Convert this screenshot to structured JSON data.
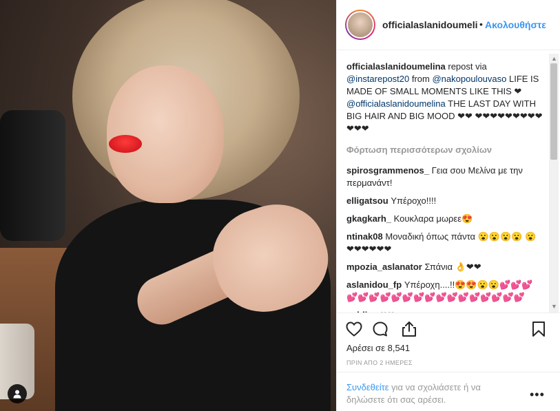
{
  "post": {
    "username": "officialaslanidoumelina",
    "header_username": "officialaslanidoumeli",
    "dot": "•",
    "follow_label": "Ακολουθήστε",
    "caption": {
      "user": "officialaslanidoumelina",
      "part1": " repost via ",
      "mention1": "@instarepost20",
      "part2": " from ",
      "mention2": "@nakopoulouvaso",
      "part3": " LIFE IS MADE OF SMALL MOMENTS LIKE THIS ❤ ",
      "mention3": "@officialaslanidoumelina",
      "part4": " THE LAST DAY WITH BIG HAIR AND BIG MOOD ❤❤ ❤❤❤❤❤❤❤❤❤❤❤❤"
    },
    "load_more": "Φόρτωση περισσότερων σχολίων",
    "comments": [
      {
        "user": "spirosgrammenos_",
        "text": "Γεια σου Μελίνα με την περμανάντ!"
      },
      {
        "user": "elligatsou",
        "text": "Υπέροχο!!!!"
      },
      {
        "user": "gkagkarh_",
        "text": "Κουκλαρα μωρεε😍"
      },
      {
        "user": "ntinak08",
        "text": "Μοναδική όπως πάντα 😮😮😮😮 😮❤❤❤❤❤❤"
      },
      {
        "user": "mpozia_aslanator",
        "text": "Σπάνια 👌❤❤"
      },
      {
        "user": "aslanidou_fp",
        "text": "Υπέροχη....!!😍😍😮😮💕💕💕💕💕💕💕💕💕💕💕💕💕💕💕💕💕💕💕"
      },
      {
        "user": "cpblies",
        "text": "❤❤"
      }
    ],
    "likes": "Αρέσει σε 8,541",
    "time_ago": "ΠΡΙΝ ΑΠΟ 2 ΗΜΕΡΕΣ",
    "login_link": "Συνδεθείτε",
    "login_text": " για να σχολιάσετε ή να δηλώσετε ότι σας αρέσει.",
    "more_options": "•••"
  },
  "icons": {
    "like": "heart-icon",
    "comment": "comment-bubble-icon",
    "share": "share-icon",
    "save": "bookmark-icon",
    "user_tag": "user-tag-icon"
  },
  "colors": {
    "link_blue": "#3897f0",
    "mention": "#003569",
    "text": "#262626",
    "muted": "#999999",
    "lips_red": "#d9141c"
  }
}
